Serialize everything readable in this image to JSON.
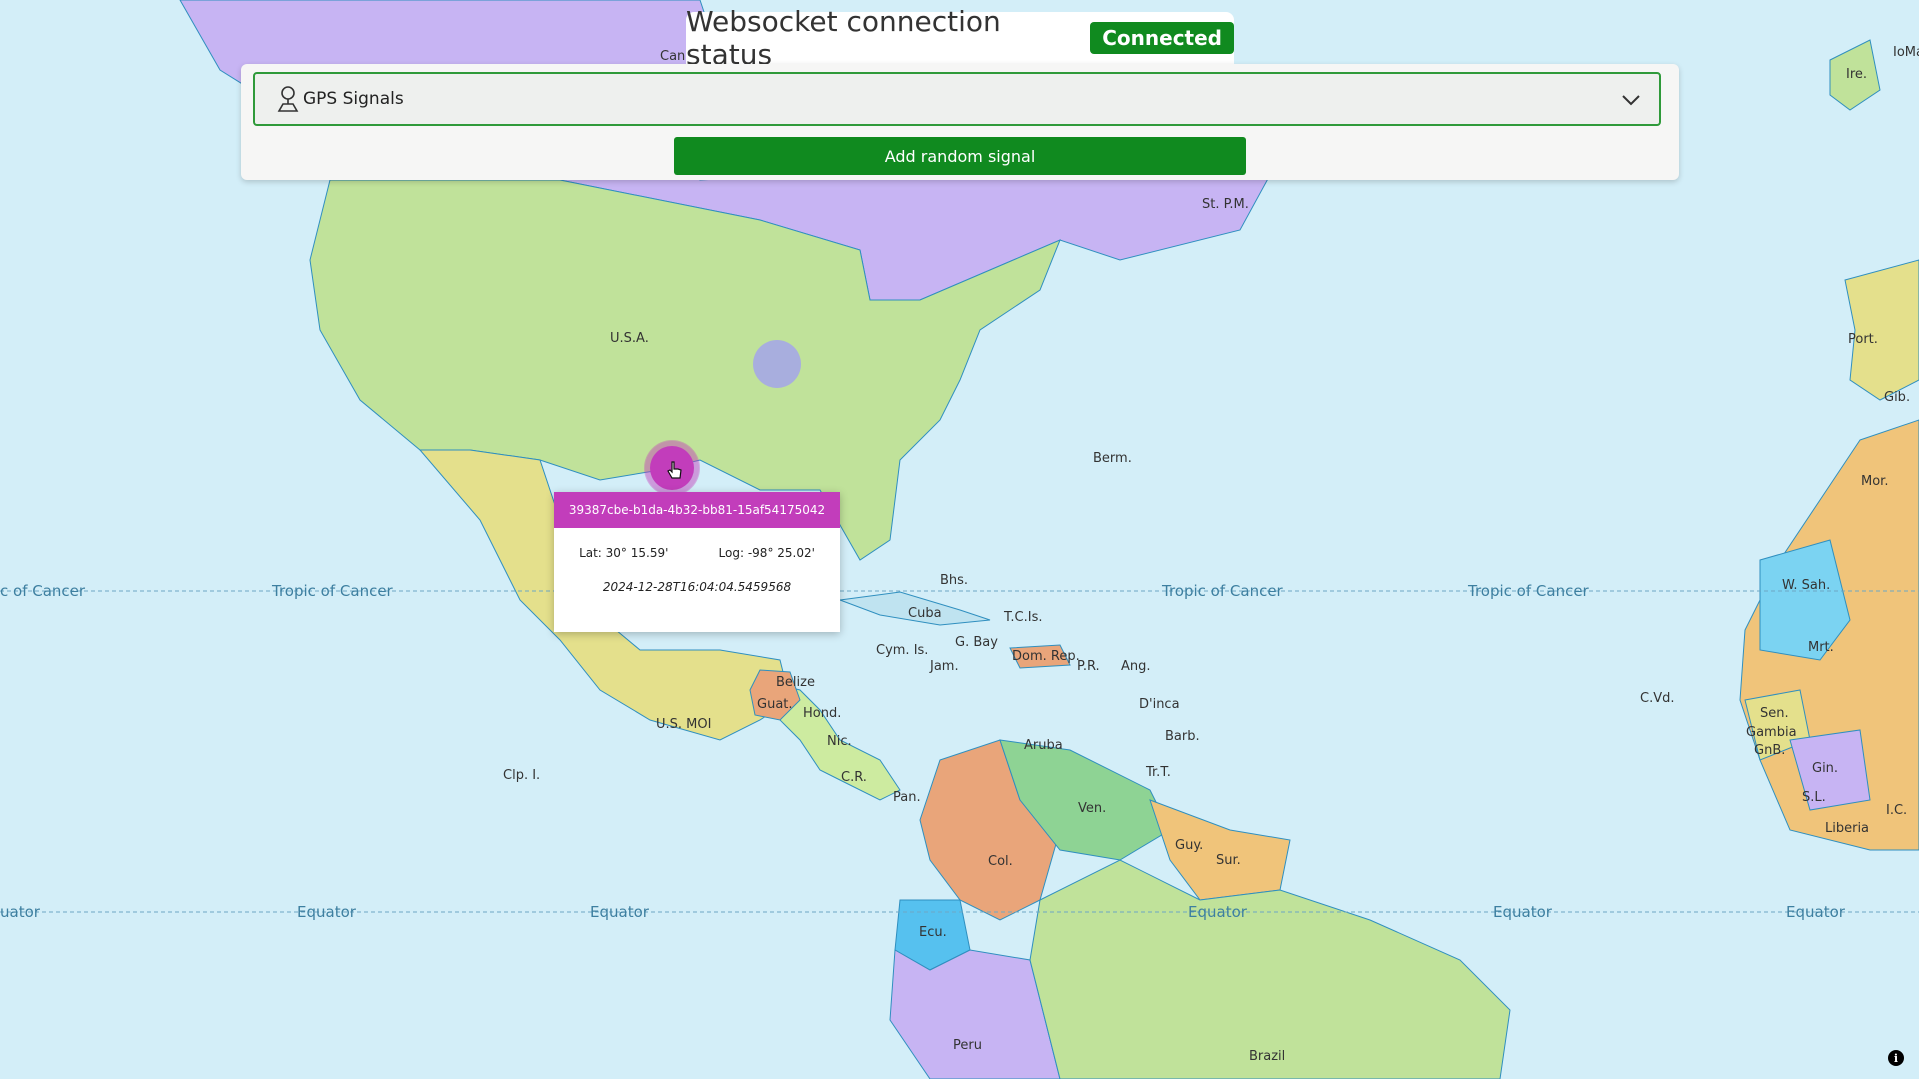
{
  "status": {
    "title": "Websocket connection status",
    "badge": "Connected"
  },
  "signals": {
    "select_value": "GPS Signals",
    "add_button": "Add random signal"
  },
  "popup": {
    "id": "39387cbe-b1da-4b32-bb81-15af54175042",
    "lat": "Lat: 30° 15.59'",
    "log": "Log: -98° 25.02'",
    "timestamp": "2024-12-28T16:04:04.5459568"
  },
  "map": {
    "labels": {
      "can": "Can.",
      "usa": "U.S.A.",
      "berm": "Berm.",
      "stpm": "St. P.M.",
      "bhs": "Bhs.",
      "cuba": "Cuba",
      "tcis": "T.C.Is.",
      "cym": "Cym. Is.",
      "gbay": "G. Bay",
      "jam": "Jam.",
      "domrep": "Dom. Rep.",
      "pr": "P.R.",
      "ang": "Ang.",
      "dinca": "D'inca",
      "barb": "Barb.",
      "trt": "Tr.T.",
      "aruba": "Aruba",
      "belize": "Belize",
      "guat": "Guat.",
      "hond": "Hond.",
      "nic": "Nic.",
      "cr": "C.R.",
      "pan": "Pan.",
      "usmoi": "U.S. MOI",
      "clpi": "Clp. I.",
      "ven": "Ven.",
      "col": "Col.",
      "guy": "Guy.",
      "sur": "Sur.",
      "ecu": "Ecu.",
      "peru": "Peru",
      "brazil": "Brazil",
      "ire": "Ire.",
      "ioma": "IoMa",
      "port": "Port.",
      "gib": "Gib.",
      "mor": "Mor.",
      "wsah": "W. Sah.",
      "mrt": "Mrt.",
      "sen": "Sen.",
      "gambia": "Gambia",
      "gnb": "GnB.",
      "gin": "Gin.",
      "sl": "S.L.",
      "ic": "I.C.",
      "liberia": "Liberia",
      "cvd": "C.Vd."
    },
    "lines": {
      "tropic": "Tropic of Cancer",
      "tropic_left": "c of Cancer",
      "equator": "Equator",
      "equator_left": "uator"
    }
  },
  "colors": {
    "accent": "#108a1f",
    "marker": "#c23dbb",
    "water": "#d3eef8"
  },
  "icons": {
    "select": "person-pin-icon",
    "chevron": "chevron-down-icon",
    "info": "info-icon",
    "cursor": "hand-cursor-icon"
  }
}
